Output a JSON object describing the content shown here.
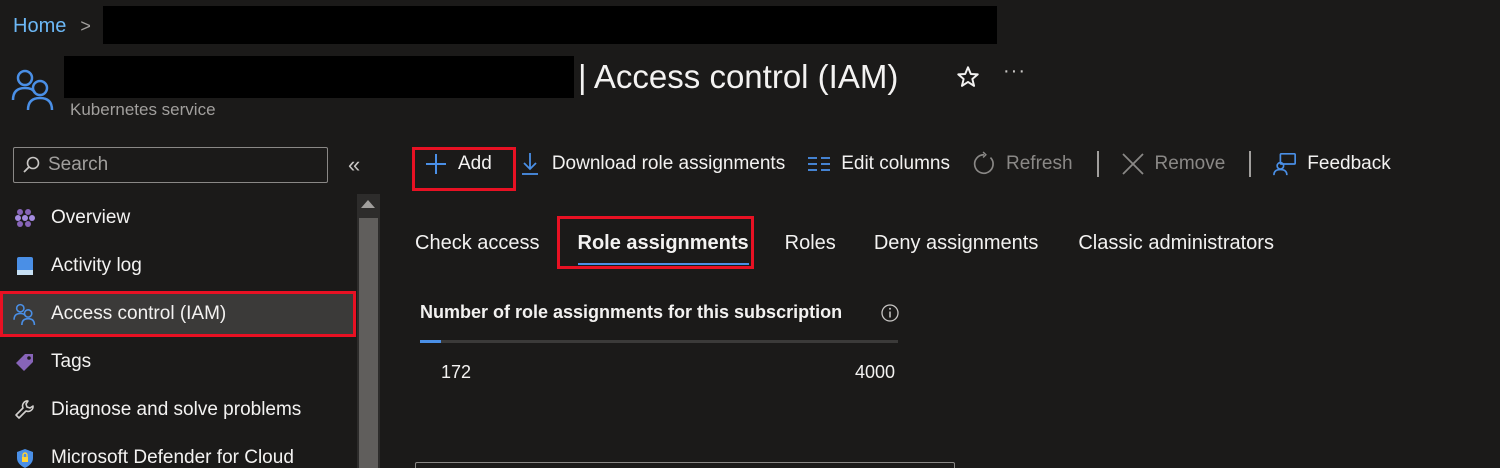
{
  "breadcrumb": {
    "home": "Home",
    "separator": ">"
  },
  "header": {
    "title": "| Access control (IAM)",
    "subtitle": "Kubernetes service",
    "more": "···"
  },
  "sidebar": {
    "search_placeholder": "Search",
    "collapse": "«",
    "items": [
      {
        "label": "Overview",
        "icon": "overview-icon"
      },
      {
        "label": "Activity log",
        "icon": "activity-log-icon"
      },
      {
        "label": "Access control (IAM)",
        "icon": "people-icon",
        "active": true
      },
      {
        "label": "Tags",
        "icon": "tag-icon"
      },
      {
        "label": "Diagnose and solve problems",
        "icon": "wrench-icon"
      },
      {
        "label": "Microsoft Defender for Cloud",
        "icon": "shield-icon"
      }
    ]
  },
  "toolbar": {
    "add": "Add",
    "download": "Download role assignments",
    "edit_columns": "Edit columns",
    "refresh": "Refresh",
    "remove": "Remove",
    "feedback": "Feedback"
  },
  "tabs": [
    {
      "label": "Check access"
    },
    {
      "label": "Role assignments",
      "active": true
    },
    {
      "label": "Roles"
    },
    {
      "label": "Deny assignments"
    },
    {
      "label": "Classic administrators"
    }
  ],
  "role_count": {
    "label": "Number of role assignments for this subscription",
    "current": "172",
    "max": "4000",
    "fraction": 0.043
  },
  "colors": {
    "accent": "#4a8fe6",
    "highlight": "#e81123",
    "background": "#1b1a19"
  }
}
